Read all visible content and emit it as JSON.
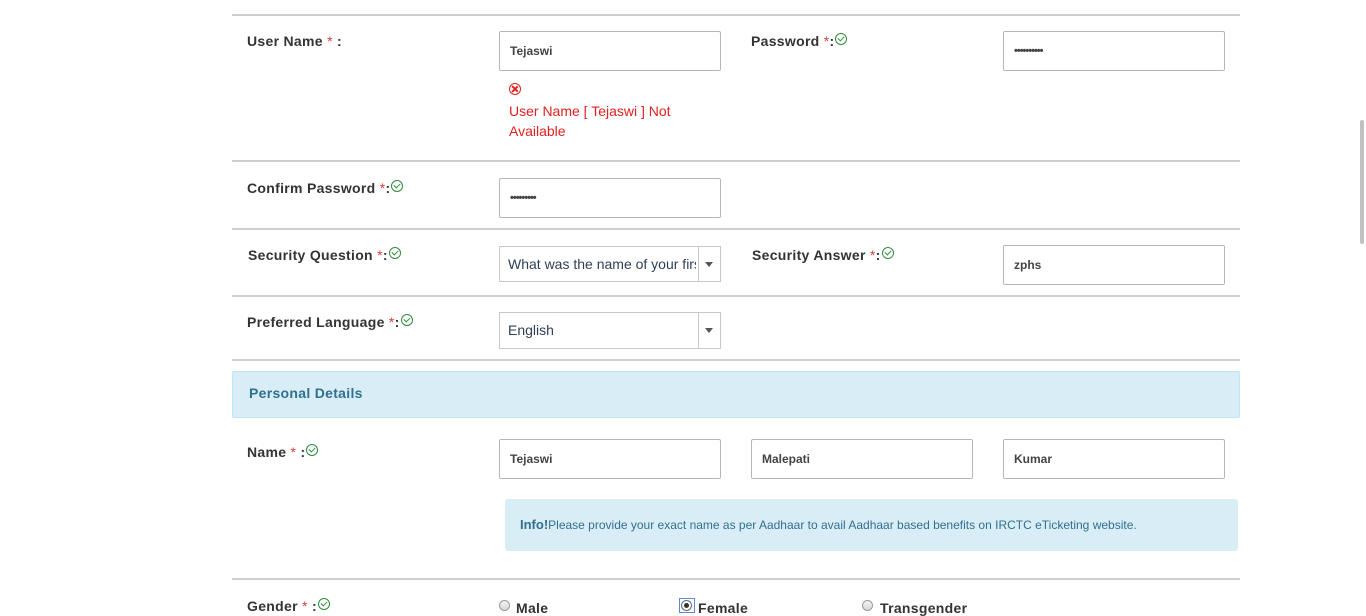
{
  "form": {
    "username": {
      "label": "User Name",
      "required_mark": "*",
      "suffix": " :",
      "value": "Tejaswi",
      "error": "User Name [ Tejaswi ] Not Available"
    },
    "password": {
      "label": "Password",
      "required_mark": "*",
      "suffix": ":",
      "value": "••••••••••"
    },
    "confirm_password": {
      "label": "Confirm Password",
      "required_mark": "*",
      "suffix": ":",
      "value": "•••••••••"
    },
    "security_question": {
      "label": "Security Question",
      "required_mark": "*",
      "suffix": ":",
      "selected": "What was the name of your first"
    },
    "security_answer": {
      "label": "Security Answer",
      "required_mark": "*",
      "suffix": ":",
      "value": "zphs"
    },
    "preferred_language": {
      "label": "Preferred Language",
      "required_mark": "*",
      "suffix": ":",
      "selected": "English"
    }
  },
  "personal_details": {
    "heading": "Personal Details",
    "name": {
      "label": "Name",
      "required_mark": "*",
      "suffix": " :",
      "first": "Tejaswi",
      "middle": "Malepati",
      "last": "Kumar"
    },
    "info": {
      "strong": "Info!",
      "text": "Please provide your exact name as per Aadhaar to avail Aadhaar based benefits on IRCTC eTicketing website."
    },
    "gender": {
      "label": "Gender",
      "required_mark": "*",
      "suffix": " :",
      "options": [
        "Male",
        "Female",
        "Transgender"
      ],
      "selected": "Female"
    }
  },
  "colors": {
    "required": "#e03b3b",
    "valid": "#2e8b3a",
    "error": "#e02020",
    "panel_bg": "#d9edf7",
    "panel_text": "#31708f"
  },
  "icons": {
    "valid": "check-circle-icon",
    "error": "x-circle-icon",
    "dropdown": "caret-down-icon"
  }
}
